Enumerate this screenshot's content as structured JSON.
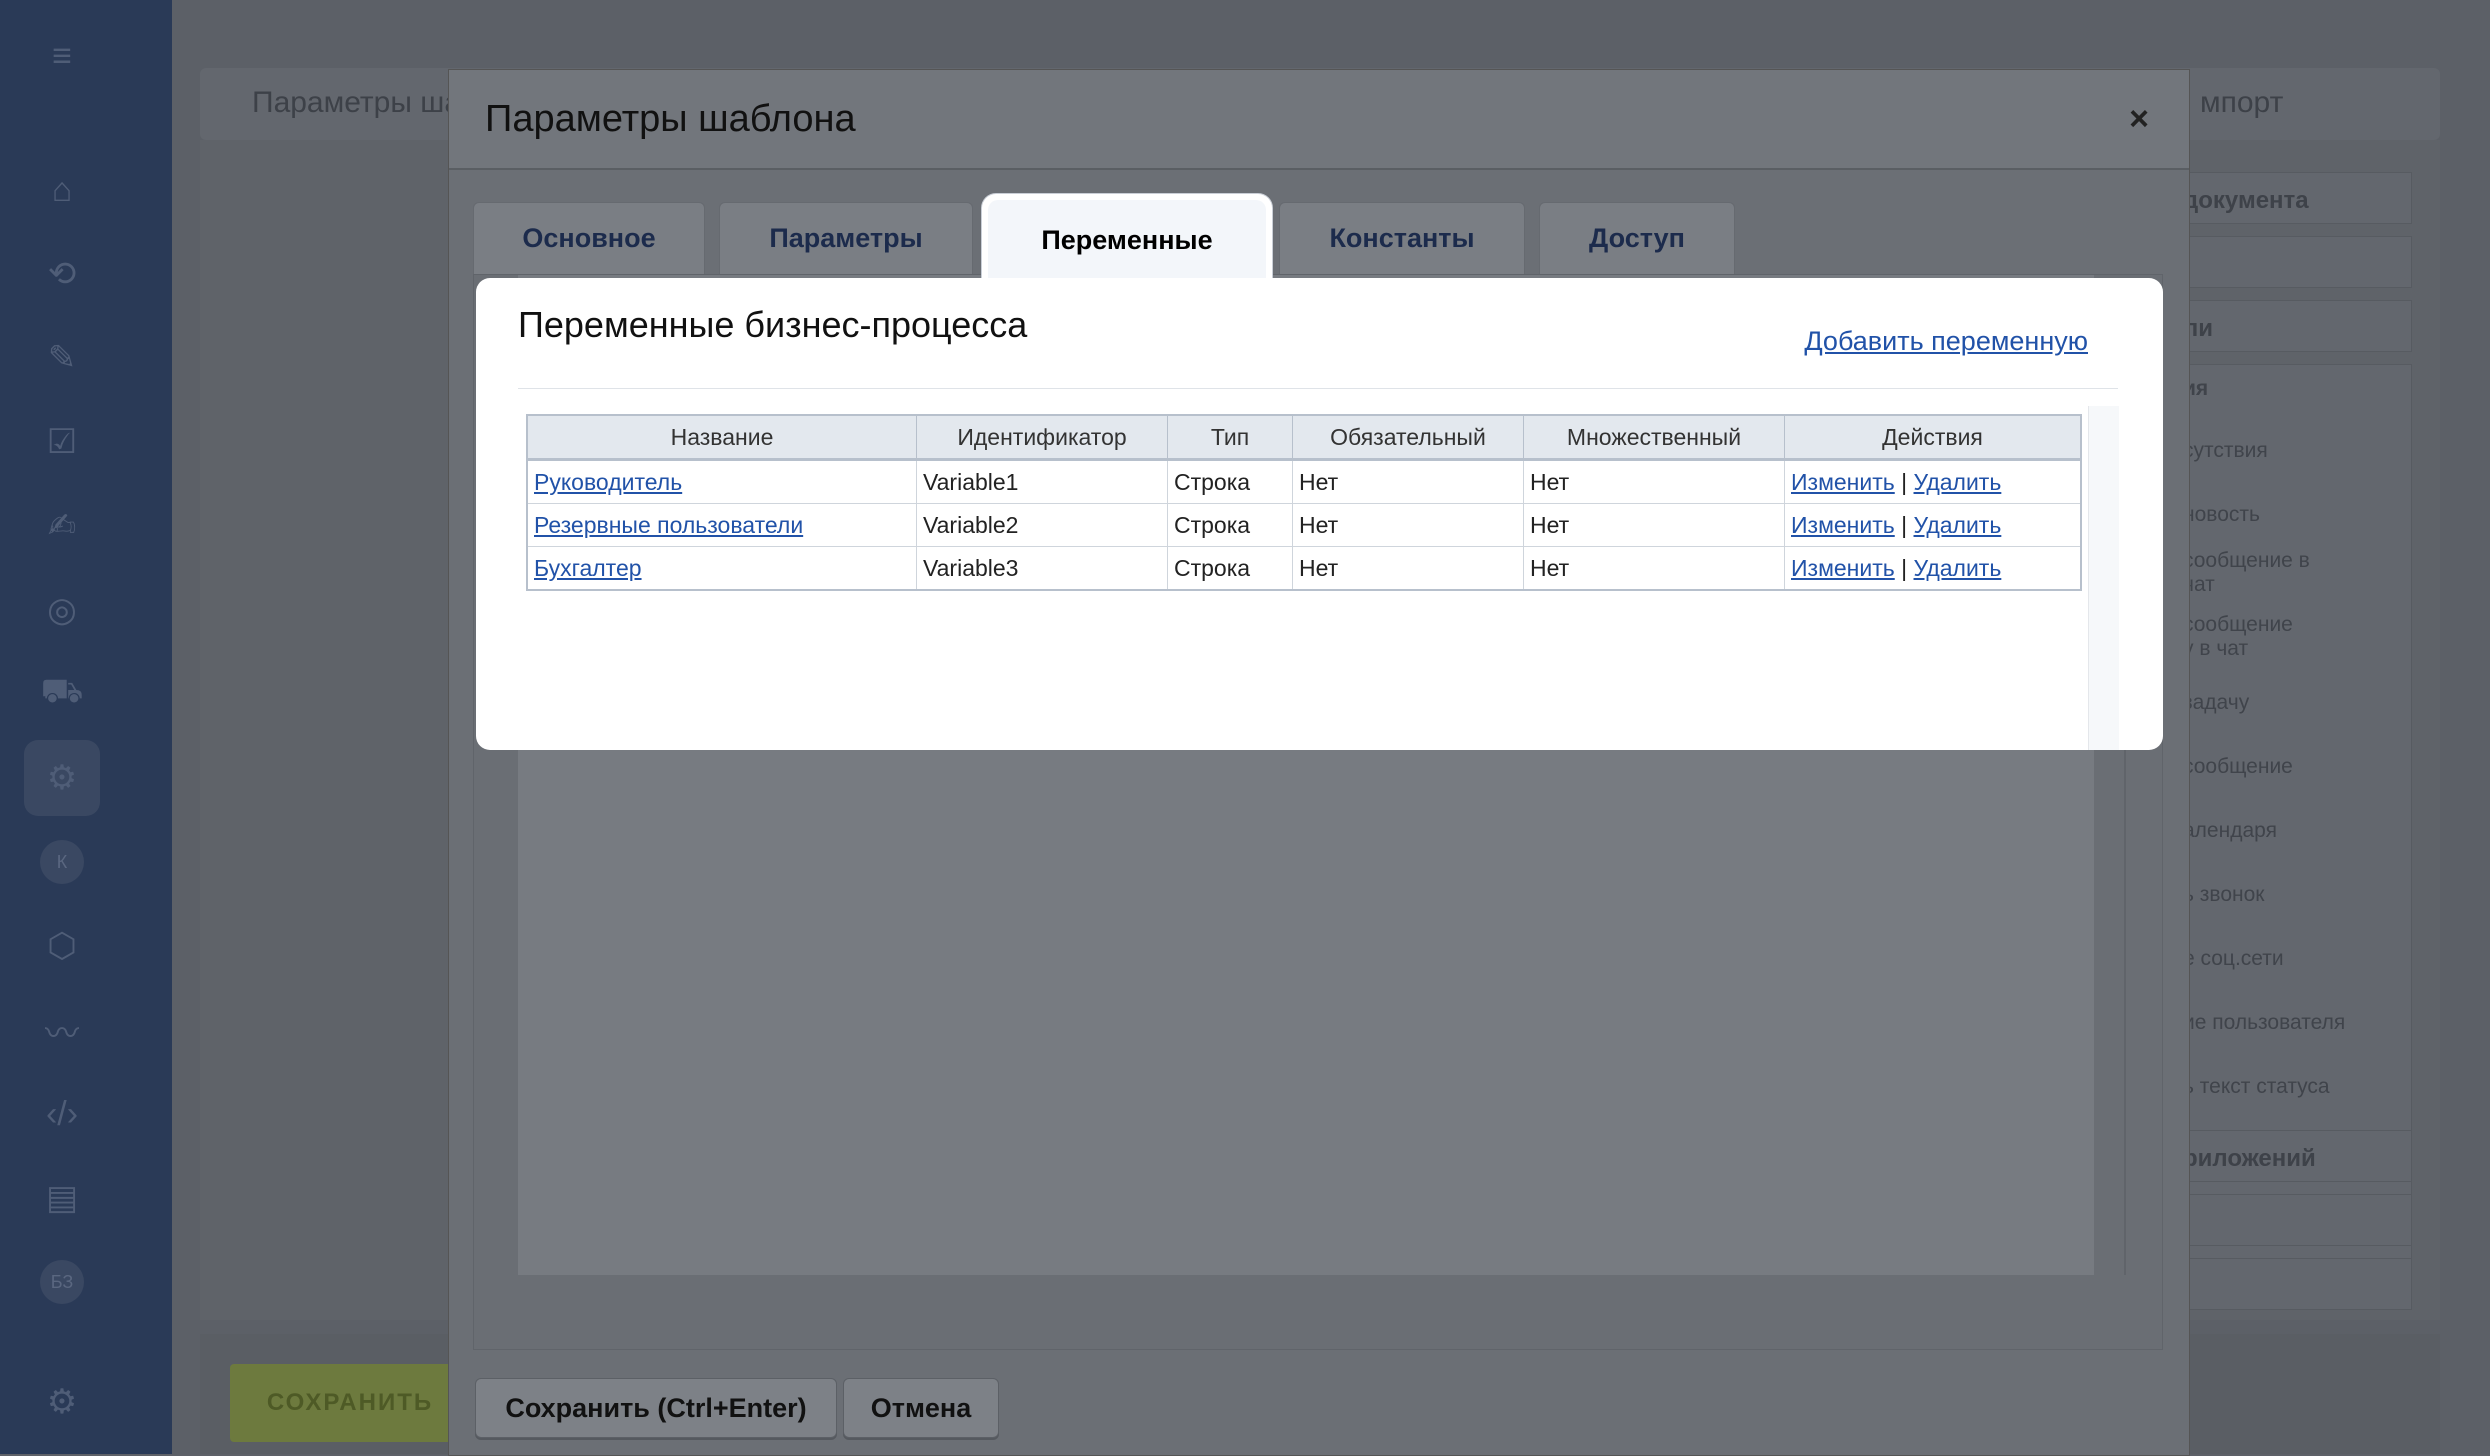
{
  "nav": {
    "icons": [
      "menu-icon",
      "home-icon",
      "flow-icon",
      "pen-icon",
      "checkbox-icon",
      "doc-edit-icon",
      "target-icon",
      "cart-icon",
      "robot-icon",
      "avatar-k",
      "box-icon",
      "signature-icon",
      "code-icon",
      "id-card-icon",
      "avatar-bz",
      "gear-icon"
    ],
    "badge_k": "К",
    "badge_bz": "БЗ"
  },
  "background": {
    "header_left": "Параметры ша",
    "header_right": "мпорт",
    "save_label": "СОХРАНИТЬ",
    "right_panel": {
      "sections": [
        "документа",
        "",
        "ли",
        "ия"
      ],
      "items": [
        "сутствия",
        "новость",
        "сообщение в\nчат",
        "сообщение\nу в чат",
        "задачу",
        "сообщение",
        "алендаря",
        "ь звонок",
        "е соц.сети",
        "ие пользователя",
        "ь текст статуса"
      ],
      "bottom_section": "риложений"
    }
  },
  "dialog": {
    "title": "Параметры шаблона",
    "close_symbol": "×",
    "tabs": [
      {
        "label": "Основное"
      },
      {
        "label": "Параметры"
      },
      {
        "label": "Переменные"
      },
      {
        "label": "Константы"
      },
      {
        "label": "Доступ"
      }
    ],
    "active_tab": "Переменные",
    "footer": {
      "save_label": "Сохранить (Ctrl+Enter)",
      "cancel_label": "Отмена"
    }
  },
  "variables_panel": {
    "title": "Переменные бизнес-процесса",
    "add_link": "Добавить переменную",
    "columns": [
      "Название",
      "Идентификатор",
      "Тип",
      "Обязательный",
      "Множественный",
      "Действия"
    ],
    "rows": [
      {
        "name": "Руководитель",
        "id": "Variable1",
        "type": "Строка",
        "required": "Нет",
        "multiple": "Нет"
      },
      {
        "name": "Резервные пользователи",
        "id": "Variable2",
        "type": "Строка",
        "required": "Нет",
        "multiple": "Нет"
      },
      {
        "name": "Бухгалтер",
        "id": "Variable3",
        "type": "Строка",
        "required": "Нет",
        "multiple": "Нет"
      }
    ],
    "action_edit": "Изменить",
    "action_sep": "|",
    "action_delete": "Удалить"
  }
}
